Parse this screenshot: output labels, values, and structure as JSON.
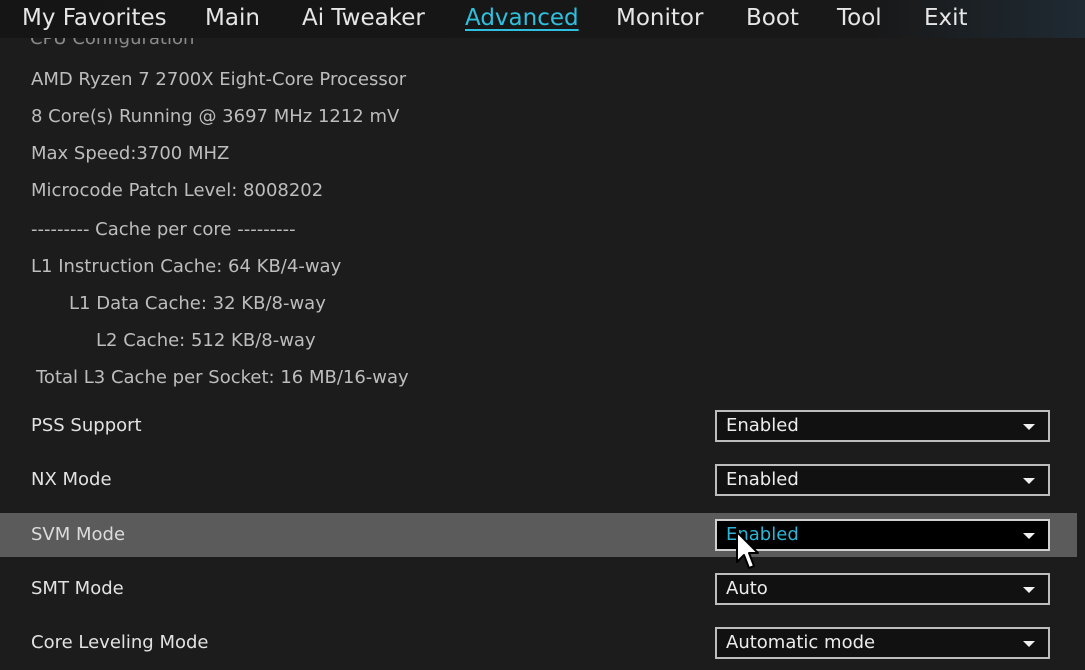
{
  "menu": {
    "items": [
      {
        "label": "My Favorites"
      },
      {
        "label": "Main"
      },
      {
        "label": "Ai Tweaker"
      },
      {
        "label": "Advanced",
        "active": true
      },
      {
        "label": "Monitor"
      },
      {
        "label": "Boot"
      },
      {
        "label": "Tool"
      },
      {
        "label": "Exit"
      }
    ]
  },
  "section_header": "CPU Configuration",
  "cpu_info": {
    "processor": "AMD Ryzen 7 2700X Eight-Core Processor",
    "running": "8 Core(s) Running @ 3697 MHz  1212 mV",
    "max_speed": "Max Speed:3700 MHZ",
    "microcode": "Microcode Patch Level: 8008202",
    "cache_header": "--------- Cache per core ---------",
    "l1_instruction": "L1 Instruction Cache: 64 KB/4-way",
    "l1_data": "L1 Data Cache: 32 KB/8-way",
    "l2": "L2 Cache: 512 KB/8-way",
    "l3": "Total L3 Cache per Socket: 16 MB/16-way"
  },
  "settings": [
    {
      "label": "PSS Support",
      "value": "Enabled"
    },
    {
      "label": "NX Mode",
      "value": "Enabled"
    },
    {
      "label": "SVM Mode",
      "value": "Enabled",
      "selected": true
    },
    {
      "label": "SMT Mode",
      "value": "Auto"
    },
    {
      "label": "Core Leveling Mode",
      "value": "Automatic mode"
    }
  ],
  "colors": {
    "accent": "#2fc0e0",
    "background": "#1c1c1c",
    "selected_row": "#5b5b5b"
  }
}
